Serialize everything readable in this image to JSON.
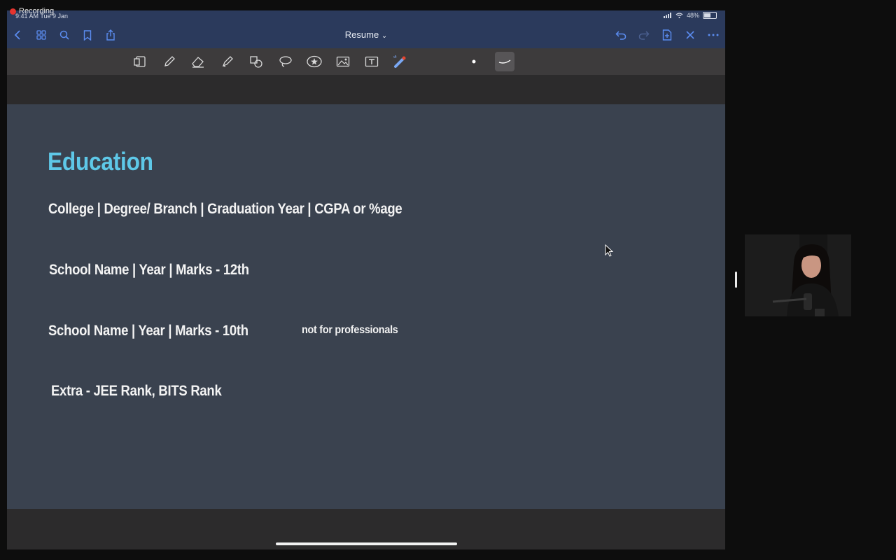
{
  "recording": {
    "label": "Recording"
  },
  "statusbar": {
    "time": "9:41 AM  Tue 9 Jan",
    "battery": "48%"
  },
  "navbar": {
    "title": "Resume",
    "title_chevron": "⌄",
    "left_icons": [
      "back-icon",
      "grid-icon",
      "search-icon",
      "bookmark-icon",
      "share-icon"
    ],
    "right_icons": [
      "undo-icon",
      "redo-icon",
      "add-page-icon",
      "close-icon",
      "more-icon"
    ]
  },
  "toolbar": {
    "tools": [
      "reader-icon",
      "pen-icon",
      "eraser-icon",
      "highlighter-icon",
      "shapes-icon",
      "lasso-icon",
      "sticker-icon",
      "image-icon",
      "text-icon",
      "laser-icon",
      "dot-size-icon",
      "stroke-style-icon"
    ]
  },
  "page": {
    "heading": "Education",
    "lines": [
      "College | Degree/ Branch | Graduation Year | CGPA or %age",
      "School Name | Year | Marks - 12th",
      "School Name | Year | Marks - 10th",
      "Extra - JEE Rank, BITS Rank"
    ],
    "note": "not for professionals"
  },
  "colors": {
    "heading": "#5ec8e8",
    "page_bg": "#3a424f",
    "navbar_bg": "#2b3a5c",
    "toolbar_bg": "#3d3b3c"
  }
}
